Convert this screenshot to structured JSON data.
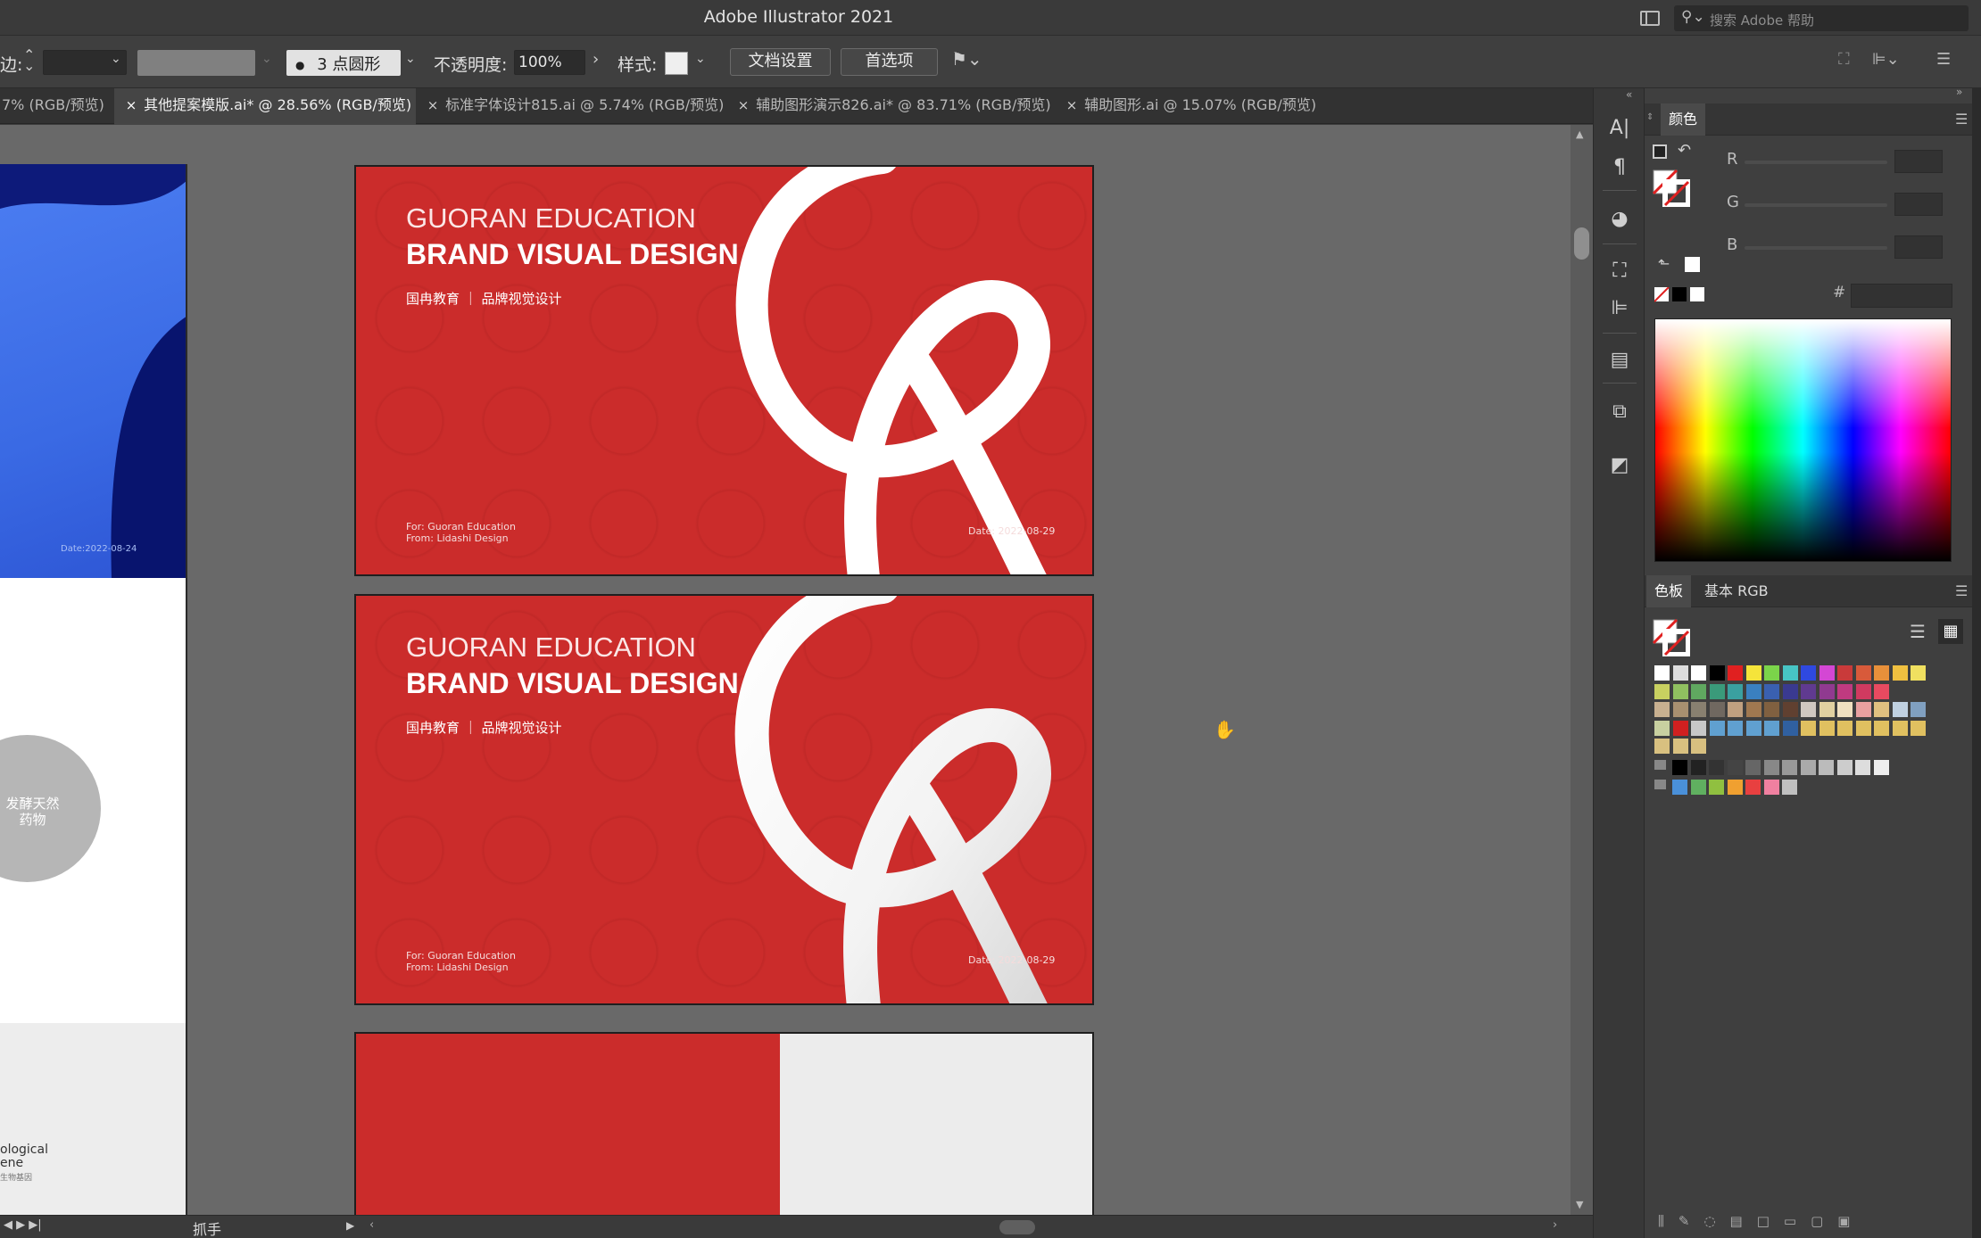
{
  "app": {
    "title": "Adobe Illustrator 2021",
    "help_placeholder": "搜索 Adobe 帮助",
    "help_icon": "search-icon"
  },
  "control": {
    "stroke_label": "边:",
    "brush_label": "3 点圆形",
    "opacity_label": "不透明度:",
    "opacity_value": "100%",
    "style_label": "样式:",
    "doc_setup": "文档设置",
    "preferences": "首选项"
  },
  "tabs": [
    {
      "label": "7% (RGB/预览)",
      "active": false,
      "close": ""
    },
    {
      "label": "其他提案模版.ai* @ 28.56% (RGB/预览)",
      "active": true,
      "close": "×"
    },
    {
      "label": "标准字体设计815.ai @ 5.74% (RGB/预览)",
      "active": false,
      "close": "×"
    },
    {
      "label": "辅助图形演示826.ai* @ 83.71% (RGB/预览)",
      "active": false,
      "close": "×"
    },
    {
      "label": "辅助图形.ai @ 15.07% (RGB/预览)",
      "active": false,
      "close": "×"
    }
  ],
  "artboards": [
    {
      "en": "GUORAN EDUCATION",
      "title": "BRAND VISUAL DESIGN",
      "sub": "国冉教育 ｜ 品牌视觉设计",
      "for": "For: Guoran Education",
      "from": "From: Lidashi Design",
      "date": "Date:  2022-08-29"
    },
    {
      "en": "GUORAN EDUCATION",
      "title": "BRAND VISUAL DESIGN",
      "sub": "国冉教育 ｜ 品牌视觉设计",
      "for": "For: Guoran Education",
      "from": "From: Lidashi Design",
      "date": "Date:  2022-08-29"
    }
  ],
  "left_artboard": {
    "date": "Date:2022-08-24",
    "circle_text_1": "发酵天然",
    "circle_text_2": "药物",
    "word_1": "ological",
    "word_2": "ene",
    "word_3": "生物基因"
  },
  "status": {
    "tool": "抓手"
  },
  "color_panel": {
    "tab": "颜色",
    "r": "R",
    "g": "G",
    "b": "B",
    "hash": "#",
    "colors": {
      "white": "#ffffff",
      "black": "#000000"
    }
  },
  "swatches_panel": {
    "tab": "色板",
    "tab2": "基本 RGB"
  },
  "colors": {
    "brand_red": "#cb2c2b",
    "canvas": "#696969",
    "blue": "#3a6ae4"
  }
}
